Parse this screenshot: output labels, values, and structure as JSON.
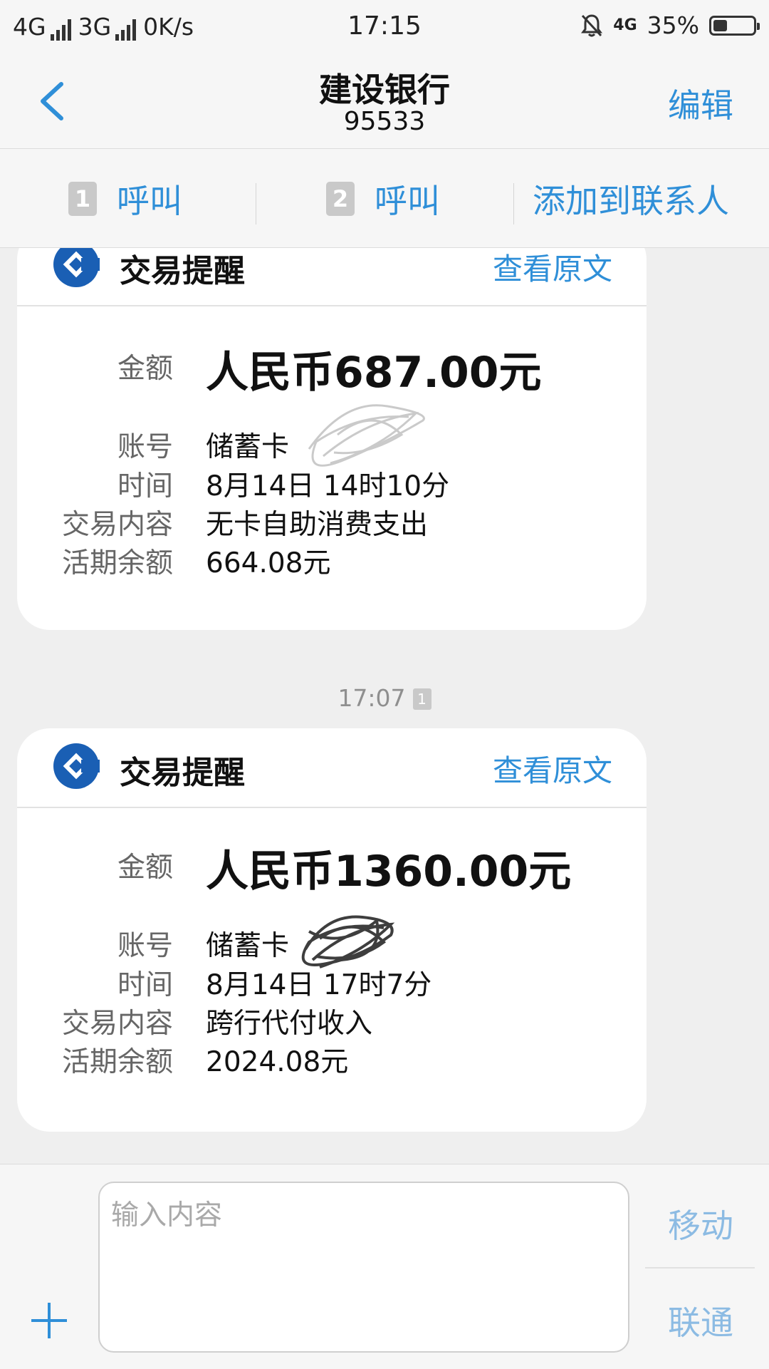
{
  "status_bar": {
    "net1": "4G",
    "net2": "3G",
    "speed": "0K/s",
    "time": "17:15",
    "net_right": "4G",
    "battery": "35%",
    "battery_level": 0.35
  },
  "header": {
    "title": "建设银行",
    "subtitle": "95533",
    "edit_label": "编辑"
  },
  "actions": {
    "sim1_badge": "1",
    "sim1_call": "呼叫",
    "sim2_badge": "2",
    "sim2_call": "呼叫",
    "add_contact": "添加到联系人"
  },
  "messages": [
    {
      "title": "交易提醒",
      "view_label": "查看原文",
      "amount_label": "金额",
      "amount": "人民币687.00元",
      "account_label": "账号",
      "account": "储蓄卡",
      "time_label": "时间",
      "time": "8月14日 14时10分",
      "content_label": "交易内容",
      "content": "无卡自助消费支出",
      "balance_label": "活期余额",
      "balance": "664.08元"
    },
    {
      "title": "交易提醒",
      "view_label": "查看原文",
      "amount_label": "金额",
      "amount": "人民币1360.00元",
      "account_label": "账号",
      "account": "储蓄卡",
      "time_label": "时间",
      "time": "8月14日 17时7分",
      "content_label": "交易内容",
      "content": "跨行代付收入",
      "balance_label": "活期余额",
      "balance": "2024.08元"
    }
  ],
  "timestamp": {
    "time": "17:07",
    "sim": "1"
  },
  "composer": {
    "placeholder": "输入内容",
    "sim_move": "移动",
    "sim_union": "联通"
  },
  "colors": {
    "accent": "#2f8fd8",
    "ccb_blue": "#1a5fb4",
    "sim_disabled": "#8cbbe3"
  },
  "icons": [
    "back-chevron-icon",
    "ccb-logo-icon",
    "plus-icon",
    "mute-bell-icon",
    "signal-icon",
    "battery-icon"
  ]
}
